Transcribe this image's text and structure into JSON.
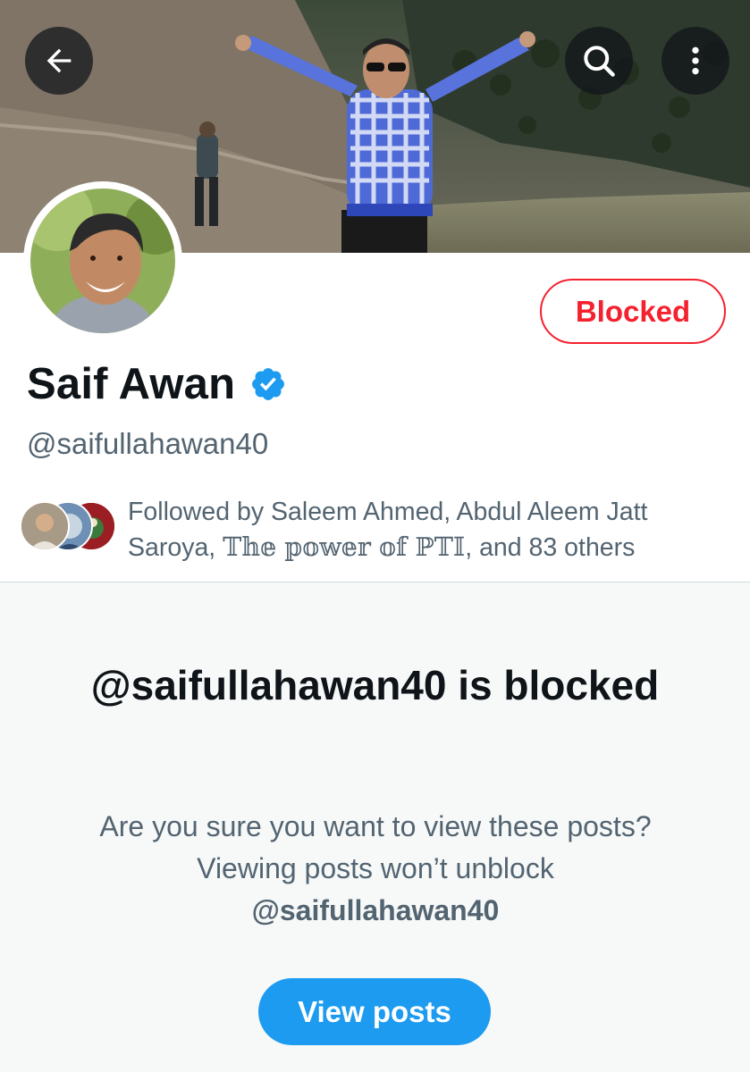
{
  "header": {
    "back_icon": "arrow-left-icon",
    "search_icon": "search-icon",
    "more_icon": "more-vertical-icon"
  },
  "profile": {
    "display_name": "Saif Awan",
    "handle": "@saifullahawan40",
    "verified": true,
    "blocked_button_label": "Blocked",
    "followed_by": {
      "prefix": "Followed by ",
      "names_plain": "Saleem Ahmed, Abdul Aleem Jatt Saroya, ",
      "name_stylized": "𝕋𝕙𝕖 𝕡𝕠𝕨𝕖𝕣 𝕠𝕗 ℙ𝕋𝕀",
      "suffix": ", and 83 others"
    }
  },
  "blocked_notice": {
    "title": "@saifullahawan40 is blocked",
    "description": "Are you sure you want to view these posts? Viewing posts won’t unblock",
    "description_handle": "@saifullahawan40",
    "button_label": "View posts"
  },
  "colors": {
    "accent_blue": "#1d9bf0",
    "blocked_red": "#f4212e",
    "secondary_text": "#536471",
    "panel_bg": "#f7f9f9"
  }
}
